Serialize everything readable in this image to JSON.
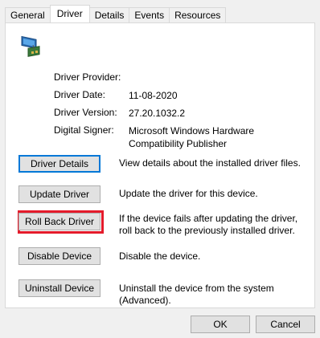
{
  "tabs": [
    "General",
    "Driver",
    "Details",
    "Events",
    "Resources"
  ],
  "icon": "network-adapter-icon",
  "properties": {
    "provider_label": "Driver Provider:",
    "provider_value": "",
    "date_label": "Driver Date:",
    "date_value": "11-08-2020",
    "version_label": "Driver Version:",
    "version_value": "27.20.1032.2",
    "signer_label": "Digital Signer:",
    "signer_value": "Microsoft Windows Hardware Compatibility Publisher"
  },
  "actions": {
    "details_label": "Driver Details",
    "details_desc": "View details about the installed driver files.",
    "update_label": "Update Driver",
    "update_desc": "Update the driver for this device.",
    "rollback_label": "Roll Back Driver",
    "rollback_desc": "If the device fails after updating the driver, roll back to the previously installed driver.",
    "disable_label": "Disable Device",
    "disable_desc": "Disable the device.",
    "uninstall_label": "Uninstall Device",
    "uninstall_desc": "Uninstall the device from the system (Advanced)."
  },
  "footer": {
    "ok_label": "OK",
    "cancel_label": "Cancel"
  },
  "colors": {
    "highlight": "#e41b2b",
    "default_button_border": "#0078d7"
  }
}
